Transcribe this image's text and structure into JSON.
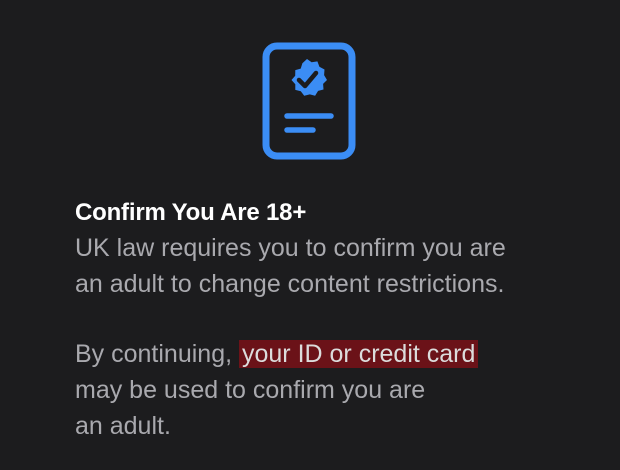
{
  "colors": {
    "background": "#1c1c1e",
    "accent": "#3b8df5",
    "title": "#ffffff",
    "body": "#a9a9ae",
    "highlight": "#6b1218"
  },
  "icon": "verified-id-document-icon",
  "title": "Confirm You Are 18+",
  "intro": {
    "line1": "UK law requires you to confirm you are",
    "line2": "an adult to change content restrictions."
  },
  "notice": {
    "prefix": "By continuing, ",
    "highlight": "your ID or credit card",
    "line2": "may be used to confirm you are",
    "line3": "an adult."
  }
}
